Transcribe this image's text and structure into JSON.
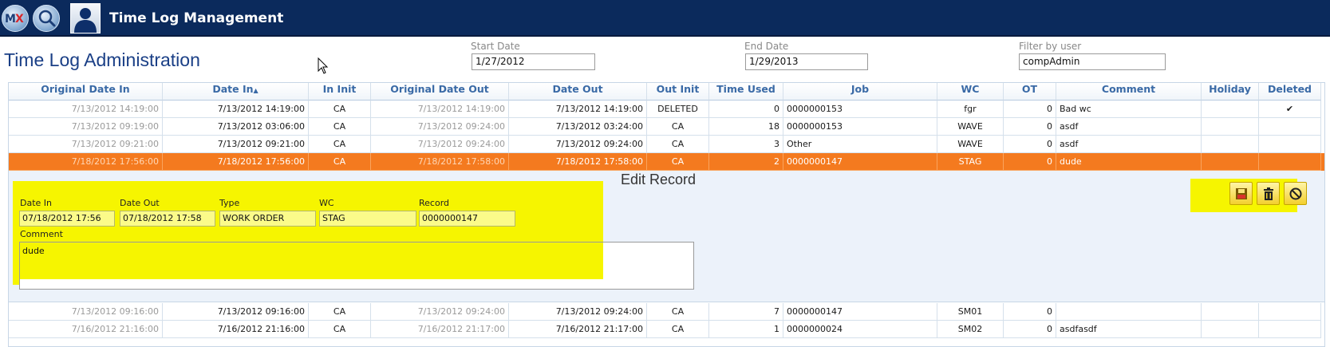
{
  "window": {
    "title": "Time Log Management"
  },
  "toolbar": {
    "mx_logo_text_m": "M",
    "mx_logo_text_x": "X",
    "mx_icon": "mx-logo-icon",
    "search_icon": "search-icon",
    "user_icon": "user-icon"
  },
  "header": {
    "page_title": "Time Log Administration",
    "filters": {
      "start_date": {
        "label": "Start Date",
        "value": "1/27/2012"
      },
      "end_date": {
        "label": "End Date",
        "value": "1/29/2013"
      },
      "user": {
        "label": "Filter by user",
        "value": "compAdmin"
      }
    }
  },
  "table": {
    "columns": [
      "Original Date In",
      "Date In",
      "In Init",
      "Original Date Out",
      "Date Out",
      "Out Init",
      "Time Used",
      "Job",
      "WC",
      "OT",
      "Comment",
      "Holiday",
      "Deleted"
    ],
    "sort_indicator": "▲",
    "rows_top": [
      [
        "7/13/2012 14:19:00",
        "7/13/2012 14:19:00",
        "CA",
        "7/13/2012 14:19:00",
        "7/13/2012 14:19:00",
        "DELETED",
        "0",
        "0000000153",
        "fgr",
        "0",
        "Bad wc",
        "",
        "✔"
      ],
      [
        "7/13/2012 09:19:00",
        "7/13/2012 03:06:00",
        "CA",
        "7/13/2012 09:24:00",
        "7/13/2012 03:24:00",
        "CA",
        "18",
        "0000000153",
        "WAVE",
        "0",
        "asdf",
        "",
        ""
      ],
      [
        "7/13/2012 09:21:00",
        "7/13/2012 09:21:00",
        "CA",
        "7/13/2012 09:24:00",
        "7/13/2012 09:24:00",
        "CA",
        "3",
        "Other",
        "WAVE",
        "0",
        "asdf",
        "",
        ""
      ]
    ],
    "selected_row": [
      "7/18/2012 17:56:00",
      "7/18/2012 17:56:00",
      "CA",
      "7/18/2012 17:58:00",
      "7/18/2012 17:58:00",
      "CA",
      "2",
      "0000000147",
      "STAG",
      "0",
      "dude",
      "",
      ""
    ],
    "rows_bottom": [
      [
        "7/13/2012 09:16:00",
        "7/13/2012 09:16:00",
        "CA",
        "7/13/2012 09:24:00",
        "7/13/2012 09:24:00",
        "CA",
        "7",
        "0000000147",
        "SM01",
        "0",
        "",
        "",
        ""
      ],
      [
        "7/16/2012 21:16:00",
        "7/16/2012 21:16:00",
        "CA",
        "7/16/2012 21:17:00",
        "7/16/2012 21:17:00",
        "CA",
        "1",
        "0000000024",
        "SM02",
        "0",
        "asdfasdf",
        "",
        ""
      ]
    ]
  },
  "edit_record": {
    "title": "Edit Record",
    "fields": {
      "date_in": {
        "label": "Date In",
        "value": "07/18/2012 17:56"
      },
      "date_out": {
        "label": "Date Out",
        "value": "07/18/2012 17:58"
      },
      "type": {
        "label": "Type",
        "value": "WORK ORDER"
      },
      "wc": {
        "label": "WC",
        "value": "STAG"
      },
      "record": {
        "label": "Record",
        "value": "0000000147"
      },
      "comment": {
        "label": "Comment",
        "value": "dude"
      }
    },
    "actions": {
      "save_icon": "save-icon",
      "delete_icon": "trash-icon",
      "cancel_icon": "cancel-icon"
    }
  },
  "colors": {
    "titlebar": "#0b2a5c",
    "selected_row": "#f47a1f",
    "highlight": "#f6f500",
    "header_text": "#3a6aa6"
  }
}
